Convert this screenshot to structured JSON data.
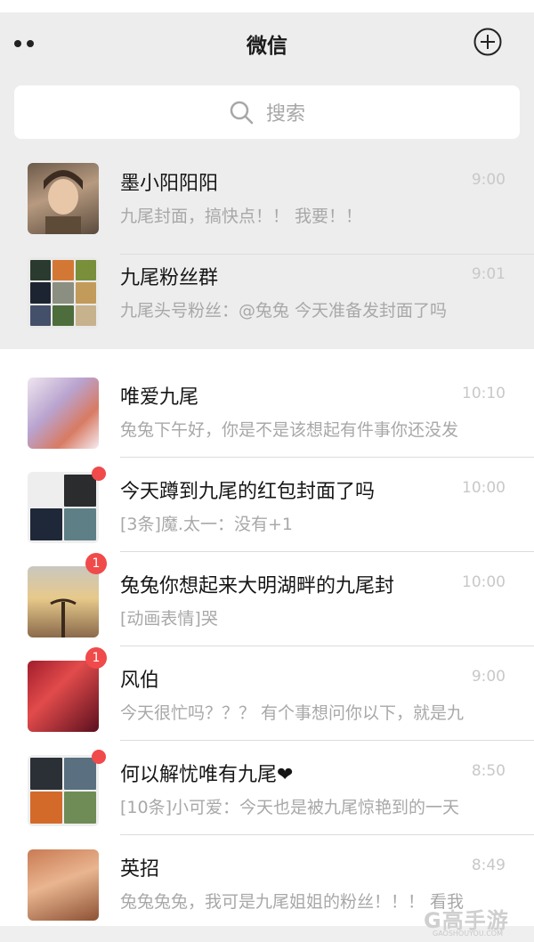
{
  "header": {
    "title": "微信",
    "search_placeholder": "搜索"
  },
  "chats": [
    {
      "name": "墨小阳阳阳",
      "preview": "九尾封面，搞快点！！ 我要！！",
      "time": "9:00",
      "badge": "",
      "dot": false,
      "pinned": true
    },
    {
      "name": "九尾粉丝群",
      "preview": "九尾头号粉丝：@兔兔  今天准备发封面了吗",
      "time": "9:01",
      "badge": "",
      "dot": false,
      "pinned": true
    },
    {
      "name": "唯爱九尾",
      "preview": "兔兔下午好，你是不是该想起有件事你还没发",
      "time": "10:10",
      "badge": "",
      "dot": false,
      "pinned": false
    },
    {
      "name": "今天蹲到九尾的红包封面了吗",
      "preview": "[3条]魔.太一：没有+1",
      "time": "10:00",
      "badge": "",
      "dot": true,
      "pinned": false
    },
    {
      "name": "兔兔你想起来大明湖畔的九尾封",
      "preview": "[动画表情]哭",
      "time": "10:00",
      "badge": "1",
      "dot": false,
      "pinned": false
    },
    {
      "name": "风伯",
      "preview": "今天很忙吗？？？ 有个事想问你以下，就是九",
      "time": "9:00",
      "badge": "1",
      "dot": false,
      "pinned": false
    },
    {
      "name": "何以解忧唯有九尾❤",
      "preview": "[10条]小可爱：今天也是被九尾惊艳到的一天",
      "time": "8:50",
      "badge": "",
      "dot": true,
      "pinned": false
    },
    {
      "name": "英招",
      "preview": "兔兔兔兔，我可是九尾姐姐的粉丝！！！ 看我",
      "time": "8:49",
      "badge": "",
      "dot": false,
      "pinned": false
    }
  ],
  "watermark": {
    "text": "G高手游",
    "sub": "GAOSHOUYOU.COM"
  },
  "colors": {
    "background": "#ededed",
    "badge": "#f04a4a",
    "text_primary": "#161616",
    "text_secondary": "#a8a8a8"
  }
}
